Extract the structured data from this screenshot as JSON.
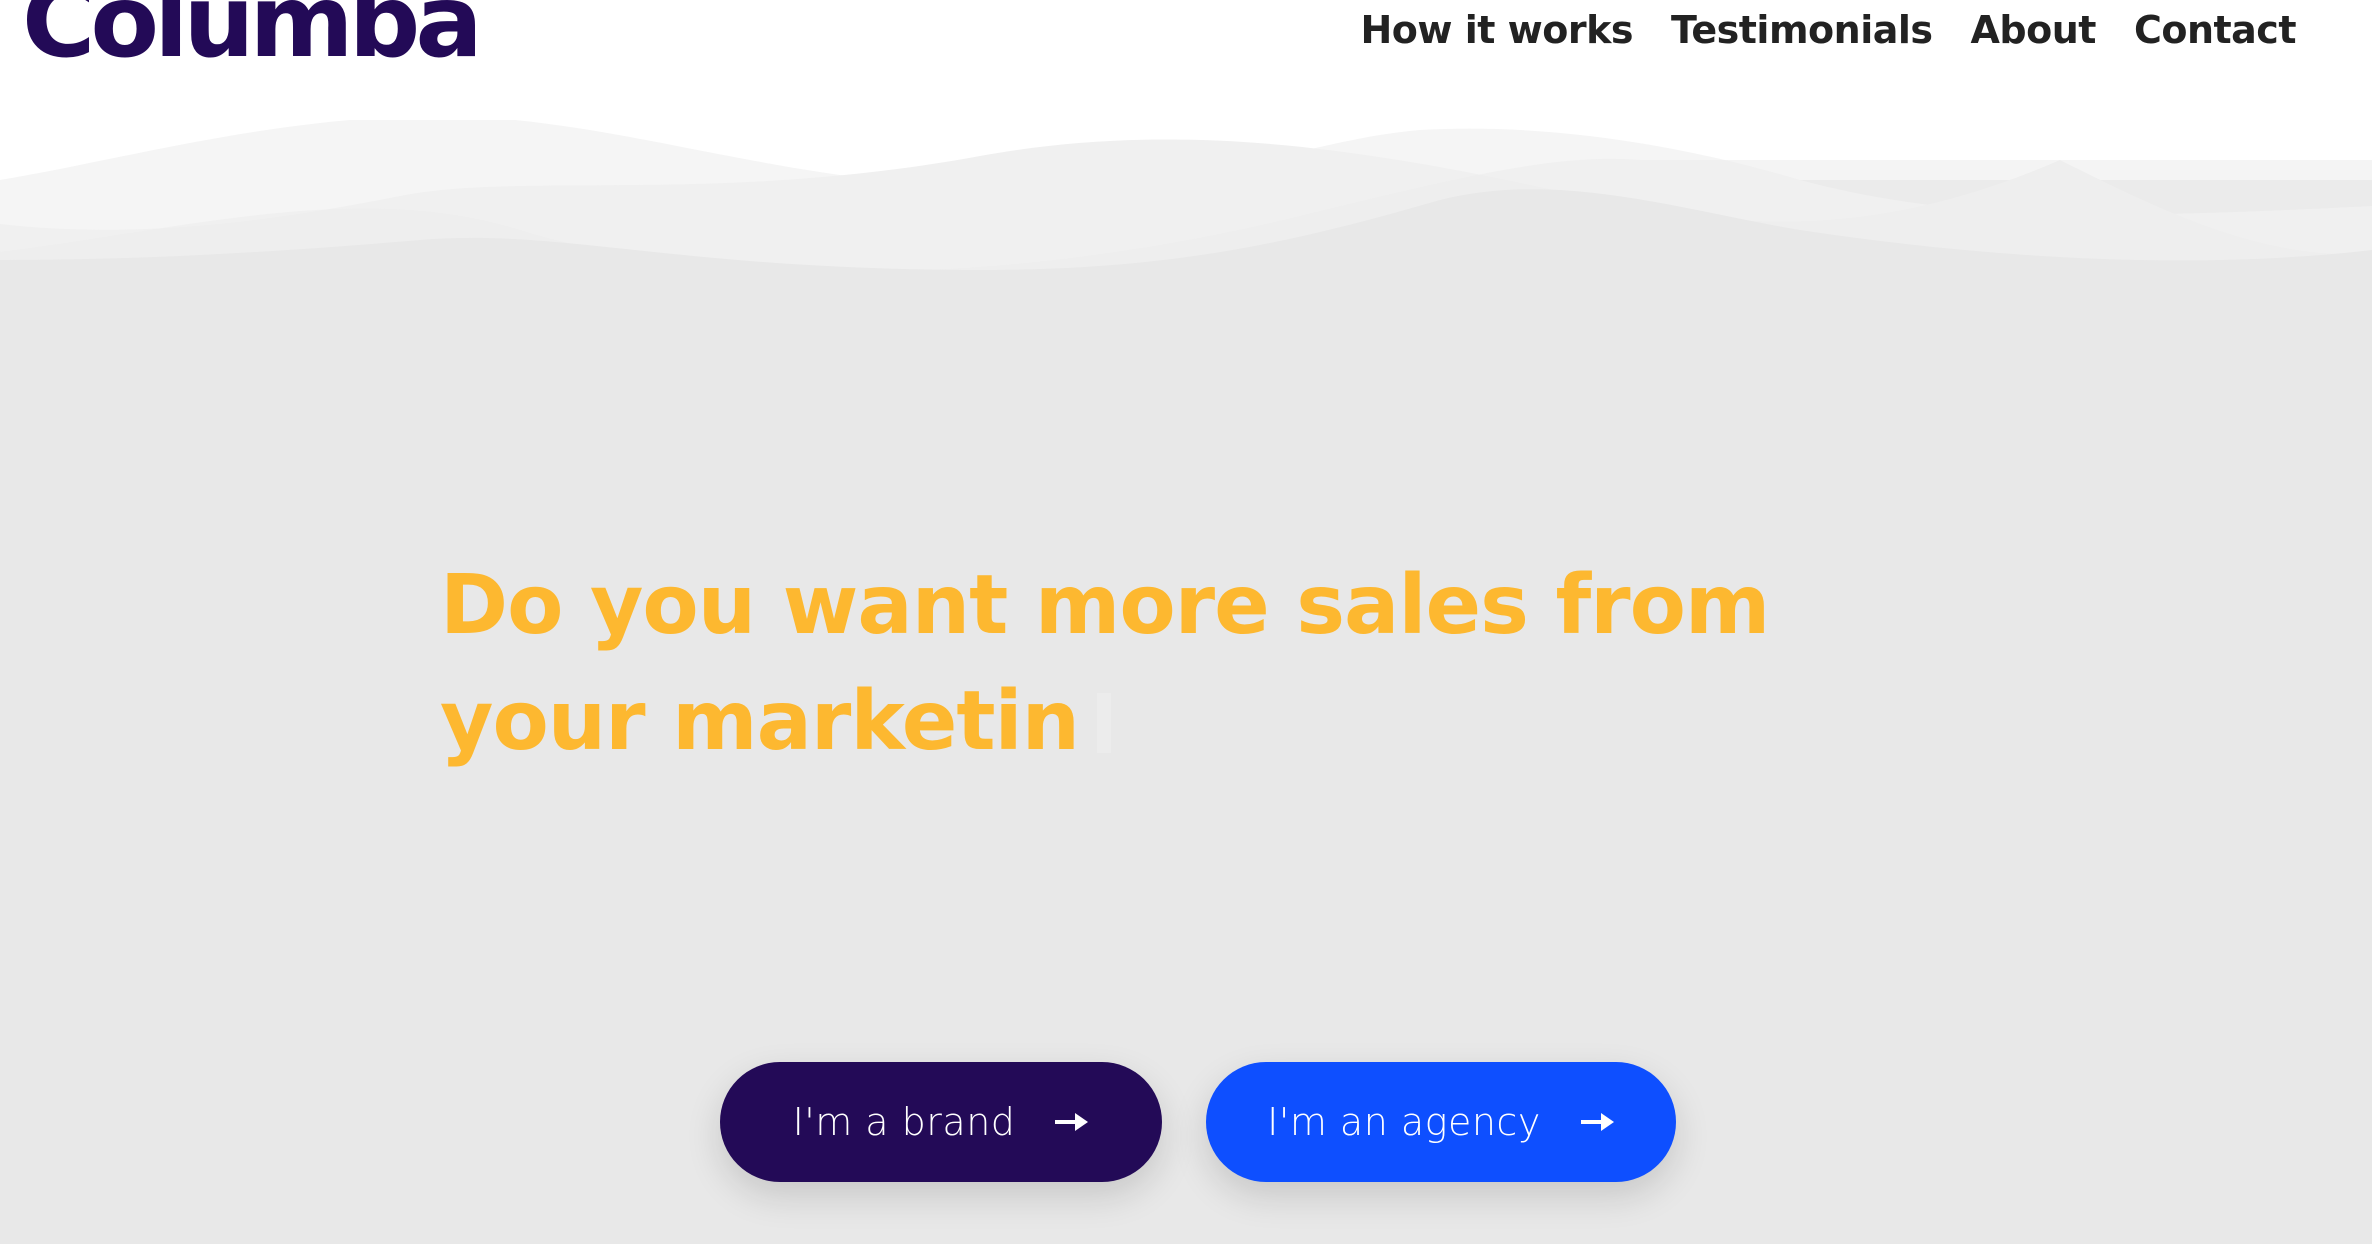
{
  "brand": {
    "logo_text": "Columba",
    "logo_color": "#230a57"
  },
  "nav": {
    "items": [
      {
        "label": "How it works"
      },
      {
        "label": "Testimonials"
      },
      {
        "label": "About"
      },
      {
        "label": "Contact"
      }
    ]
  },
  "hero": {
    "headline_line1": "Do you want more sales from",
    "headline_line2": "your marketin",
    "headline_color": "#fdb830",
    "background_color": "#e8e8e8"
  },
  "cta": {
    "brand_label": "I'm a brand",
    "brand_color": "#230a57",
    "agency_label": "I'm an agency",
    "agency_color": "#0e4fff",
    "arrow_icon": "arrow-right-icon"
  }
}
